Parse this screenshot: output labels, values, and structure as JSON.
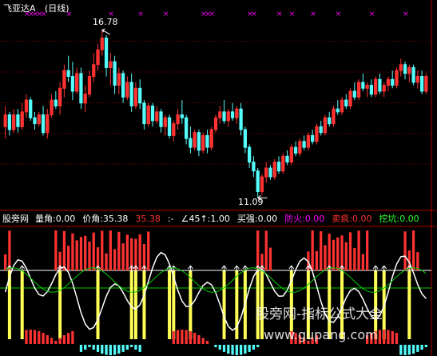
{
  "header": {
    "title": "飞亚达A",
    "period": "(日线)"
  },
  "annotations": {
    "high": "16.78",
    "low": "11.09"
  },
  "indicator": {
    "source": "股旁网",
    "items": [
      {
        "label": "量角:",
        "value": "0.00",
        "color": "#ffffff"
      },
      {
        "label": "价角:",
        "value": "35.38",
        "color": "#ffffff"
      },
      {
        "label": "",
        "value": "35.38",
        "color": "#ff3333"
      },
      {
        "label": ":-",
        "value": "",
        "color": "#ffffff"
      },
      {
        "label": "∠45↑:",
        "value": "1.00",
        "color": "#ffffff"
      },
      {
        "label": "买强:",
        "value": "0.00",
        "color": "#ffffff"
      },
      {
        "label": "防火:",
        "value": "0.00",
        "color": "#ff00ff"
      },
      {
        "label": "卖疯:",
        "value": "0.00",
        "color": "#ff3333"
      },
      {
        "label": "挖坑:",
        "value": "0.00",
        "color": "#33ff33"
      }
    ]
  },
  "watermark": {
    "text": "股旁网-指标公式大全",
    "url": "www.gupang.com"
  },
  "colors": {
    "up": "#ff3232",
    "down": "#54fcfc",
    "magenta": "#ff00ff",
    "yellow": "#ffff55",
    "green": "#00cc00",
    "white": "#ffffff",
    "grid": "#b00000"
  },
  "chart_data": [
    {
      "type": "candlestick",
      "title": "飞亚达A (日线)",
      "ylim": [
        10.8,
        17.3
      ],
      "max_label": 16.78,
      "min_label": 11.09,
      "ohlc": [
        [
          13.5,
          14.2,
          13.1,
          13.9
        ],
        [
          13.9,
          14.0,
          13.2,
          13.4
        ],
        [
          13.4,
          14.1,
          13.3,
          13.9
        ],
        [
          13.9,
          14.1,
          13.3,
          13.5
        ],
        [
          13.5,
          14.3,
          13.4,
          14.0
        ],
        [
          14.0,
          14.6,
          13.8,
          14.4
        ],
        [
          14.4,
          14.5,
          13.7,
          13.8
        ],
        [
          13.8,
          14.0,
          13.4,
          13.6
        ],
        [
          13.6,
          14.0,
          13.5,
          13.9
        ],
        [
          13.9,
          14.2,
          13.2,
          13.3
        ],
        [
          13.3,
          14.1,
          13.1,
          13.9
        ],
        [
          13.9,
          14.6,
          13.8,
          14.4
        ],
        [
          14.4,
          14.7,
          14.1,
          14.2
        ],
        [
          14.2,
          15.0,
          13.9,
          14.8
        ],
        [
          14.8,
          15.6,
          14.5,
          15.4
        ],
        [
          15.4,
          15.9,
          15.0,
          15.2
        ],
        [
          15.2,
          15.7,
          14.4,
          14.7
        ],
        [
          14.7,
          15.5,
          14.6,
          15.3
        ],
        [
          15.3,
          15.5,
          14.1,
          14.3
        ],
        [
          14.3,
          14.9,
          14.0,
          14.6
        ],
        [
          14.6,
          15.4,
          14.5,
          15.2
        ],
        [
          15.2,
          16.0,
          15.0,
          15.6
        ],
        [
          15.6,
          16.3,
          15.4,
          16.1
        ],
        [
          16.1,
          16.78,
          15.9,
          16.5
        ],
        [
          16.5,
          16.6,
          15.2,
          15.5
        ],
        [
          15.5,
          16.0,
          14.9,
          15.7
        ],
        [
          15.7,
          15.9,
          14.6,
          14.9
        ],
        [
          14.9,
          15.5,
          14.6,
          15.3
        ],
        [
          15.3,
          15.4,
          14.3,
          14.5
        ],
        [
          14.5,
          15.2,
          14.4,
          15.0
        ],
        [
          15.0,
          15.3,
          14.0,
          14.2
        ],
        [
          14.2,
          15.0,
          14.1,
          14.8
        ],
        [
          14.8,
          15.1,
          14.1,
          14.3
        ],
        [
          14.3,
          14.4,
          13.4,
          13.6
        ],
        [
          13.6,
          14.3,
          13.5,
          14.2
        ],
        [
          14.2,
          14.3,
          13.5,
          13.7
        ],
        [
          13.7,
          14.2,
          13.6,
          14.0
        ],
        [
          14.0,
          14.1,
          13.3,
          13.5
        ],
        [
          13.5,
          13.9,
          13.2,
          13.8
        ],
        [
          13.8,
          13.9,
          13.1,
          13.2
        ],
        [
          13.2,
          13.7,
          13.0,
          13.6
        ],
        [
          13.6,
          14.1,
          13.4,
          13.9
        ],
        [
          13.9,
          14.4,
          13.6,
          13.8
        ],
        [
          13.8,
          13.9,
          12.9,
          13.1
        ],
        [
          13.1,
          13.5,
          12.6,
          12.8
        ],
        [
          12.8,
          13.4,
          12.7,
          13.3
        ],
        [
          13.3,
          13.4,
          12.5,
          12.7
        ],
        [
          12.7,
          13.3,
          12.6,
          13.2
        ],
        [
          13.2,
          13.4,
          12.6,
          12.8
        ],
        [
          12.8,
          13.5,
          12.7,
          13.4
        ],
        [
          13.4,
          13.9,
          13.3,
          13.8
        ],
        [
          13.8,
          14.2,
          13.6,
          14.0
        ],
        [
          14.0,
          14.4,
          13.6,
          13.7
        ],
        [
          13.7,
          14.1,
          13.5,
          14.0
        ],
        [
          14.0,
          14.3,
          13.7,
          13.8
        ],
        [
          13.8,
          14.2,
          13.6,
          14.1
        ],
        [
          14.1,
          14.3,
          13.2,
          13.4
        ],
        [
          13.4,
          13.5,
          12.6,
          12.8
        ],
        [
          12.8,
          12.9,
          12.1,
          12.3
        ],
        [
          12.3,
          12.5,
          11.8,
          12.0
        ],
        [
          12.0,
          12.1,
          11.09,
          11.3
        ],
        [
          11.3,
          11.9,
          11.2,
          11.8
        ],
        [
          11.8,
          12.3,
          11.6,
          12.1
        ],
        [
          12.1,
          12.2,
          11.7,
          11.8
        ],
        [
          11.8,
          12.4,
          11.7,
          12.3
        ],
        [
          12.3,
          12.5,
          11.9,
          12.0
        ],
        [
          12.0,
          12.6,
          11.9,
          12.5
        ],
        [
          12.5,
          12.7,
          12.2,
          12.3
        ],
        [
          12.3,
          12.9,
          12.2,
          12.8
        ],
        [
          12.8,
          13.0,
          12.5,
          12.6
        ],
        [
          12.6,
          13.1,
          12.5,
          13.0
        ],
        [
          13.0,
          13.2,
          12.7,
          12.8
        ],
        [
          12.8,
          13.3,
          12.7,
          13.2
        ],
        [
          13.2,
          13.4,
          12.9,
          13.0
        ],
        [
          13.0,
          13.6,
          12.9,
          13.5
        ],
        [
          13.5,
          13.7,
          13.2,
          13.3
        ],
        [
          13.3,
          13.9,
          13.2,
          13.8
        ],
        [
          13.8,
          14.0,
          13.5,
          13.6
        ],
        [
          13.6,
          14.2,
          13.5,
          14.1
        ],
        [
          14.1,
          14.4,
          13.9,
          14.0
        ],
        [
          14.0,
          14.5,
          13.9,
          14.4
        ],
        [
          14.4,
          14.6,
          14.1,
          14.2
        ],
        [
          14.2,
          14.8,
          14.1,
          14.7
        ],
        [
          14.7,
          15.0,
          14.4,
          14.5
        ],
        [
          14.5,
          15.1,
          14.4,
          15.0
        ],
        [
          15.0,
          15.3,
          14.7,
          14.8
        ],
        [
          14.8,
          15.0,
          14.5,
          14.9
        ],
        [
          14.9,
          15.1,
          14.5,
          14.6
        ],
        [
          14.6,
          15.2,
          14.5,
          15.1
        ],
        [
          15.1,
          15.3,
          14.6,
          14.7
        ],
        [
          14.7,
          15.0,
          14.5,
          14.9
        ],
        [
          14.9,
          15.2,
          14.7,
          15.1
        ],
        [
          15.1,
          15.4,
          14.8,
          14.9
        ],
        [
          14.9,
          15.5,
          14.8,
          15.4
        ],
        [
          15.4,
          15.8,
          15.2,
          15.6
        ],
        [
          15.6,
          15.7,
          15.1,
          15.3
        ],
        [
          15.3,
          15.6,
          15.0,
          15.5
        ],
        [
          15.5,
          15.6,
          14.9,
          15.0
        ],
        [
          15.0,
          15.4,
          14.8,
          15.2
        ],
        [
          15.2,
          15.4,
          14.6,
          14.7
        ],
        [
          14.7,
          15.3,
          14.6,
          15.2
        ]
      ]
    },
    {
      "type": "bar",
      "title": "股旁网",
      "ylim": [
        -1.2,
        1.2
      ],
      "series": [
        {
          "name": "量角",
          "values": [
            0.0
          ]
        },
        {
          "name": "价角",
          "values": [
            35.38
          ]
        },
        {
          "name": "∠45↑",
          "values": [
            1.0
          ]
        },
        {
          "name": "买强",
          "values": [
            0.0
          ]
        },
        {
          "name": "防火",
          "values": [
            0.0
          ]
        },
        {
          "name": "卖疯",
          "values": [
            0.0
          ]
        },
        {
          "name": "挖坑",
          "values": [
            0.0
          ]
        }
      ]
    }
  ]
}
